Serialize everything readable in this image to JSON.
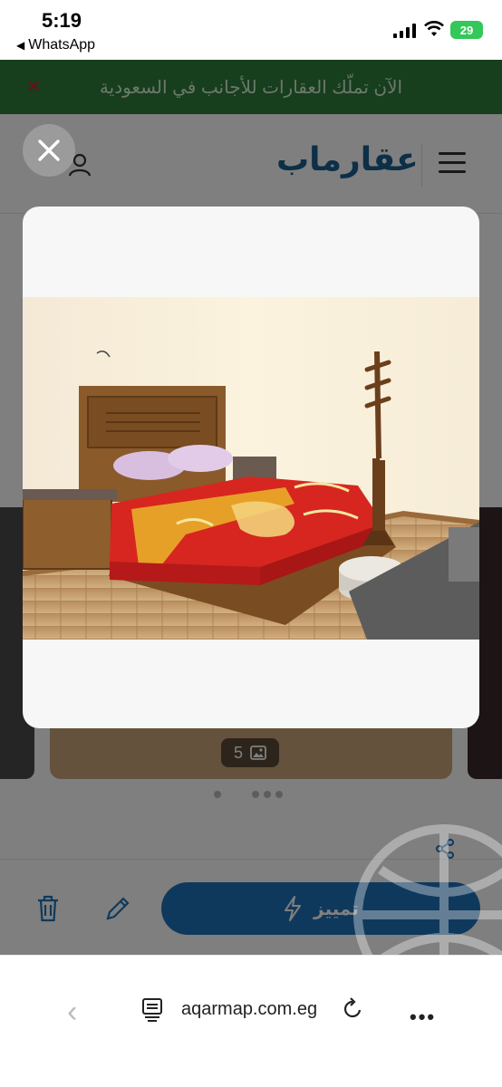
{
  "status_bar": {
    "time": "5:19",
    "back_app": "WhatsApp",
    "battery": "29"
  },
  "promo_banner": {
    "text": "الآن تملّك العقارات للأجانب في السعودية",
    "close": "×"
  },
  "header": {
    "logo": "عقارماب"
  },
  "gallery": {
    "photo_count": "5",
    "dot_count": 5,
    "active_dot": 1
  },
  "actions": {
    "promote_label": "تمييز"
  },
  "browser": {
    "url": "aqarmap.com.eg",
    "back": "‹",
    "more": "•••"
  },
  "colors": {
    "brand_blue": "#1e72b8",
    "promo_green": "#2f7d3a",
    "battery_green": "#34c759"
  }
}
